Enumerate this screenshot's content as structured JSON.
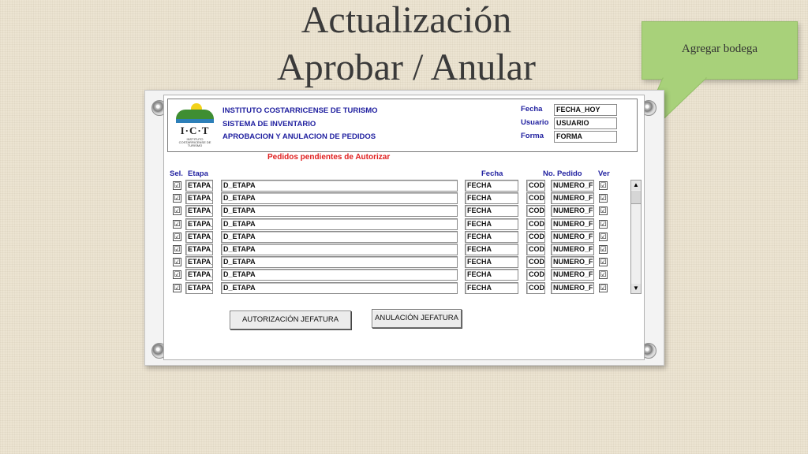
{
  "slide": {
    "title_line1": "Actualización",
    "title_line2": "Aprobar / Anular",
    "callout": "Agregar bodega"
  },
  "colors": {
    "accent_blue": "#2121a0",
    "report_red": "#e02020",
    "callout_green": "#a8d17a"
  },
  "header": {
    "logo_text": "I·C·T",
    "logo_sub": "INSTITUTO COSTARRICENSE DE TURISMO",
    "org_line1": "INSTITUTO COSTARRICENSE DE TURISMO",
    "org_line2": "SISTEMA DE INVENTARIO",
    "org_line3": "APROBACION Y ANULACION DE PEDIDOS",
    "fecha_label": "Fecha",
    "fecha_value": "FECHA_HOY",
    "usuario_label": "Usuario",
    "usuario_value": "USUARIO",
    "forma_label": "Forma",
    "forma_value": "FORMA"
  },
  "report": {
    "title": "Pedidos pendientes de Autorizar",
    "columns": {
      "sel": "Sel.",
      "etapa": "Etapa",
      "fecha": "Fecha",
      "no_pedido": "No. Pedido",
      "ver": "Ver"
    },
    "rows": [
      {
        "sel": "☑",
        "etapa": "ETAPA_",
        "d_etapa": "D_ETAPA",
        "fecha": "FECHA",
        "cod": "COD",
        "numero": "NUMERO_F",
        "ver": "☑"
      },
      {
        "sel": "☑",
        "etapa": "ETAPA_",
        "d_etapa": "D_ETAPA",
        "fecha": "FECHA",
        "cod": "COD",
        "numero": "NUMERO_F",
        "ver": "☑"
      },
      {
        "sel": "☑",
        "etapa": "ETAPA_",
        "d_etapa": "D_ETAPA",
        "fecha": "FECHA",
        "cod": "COD",
        "numero": "NUMERO_F",
        "ver": "☑"
      },
      {
        "sel": "☑",
        "etapa": "ETAPA_",
        "d_etapa": "D_ETAPA",
        "fecha": "FECHA",
        "cod": "COD",
        "numero": "NUMERO_F",
        "ver": "☑"
      },
      {
        "sel": "☑",
        "etapa": "ETAPA_",
        "d_etapa": "D_ETAPA",
        "fecha": "FECHA",
        "cod": "COD",
        "numero": "NUMERO_F",
        "ver": "☑"
      },
      {
        "sel": "☑",
        "etapa": "ETAPA_",
        "d_etapa": "D_ETAPA",
        "fecha": "FECHA",
        "cod": "COD",
        "numero": "NUMERO_F",
        "ver": "☑"
      },
      {
        "sel": "☑",
        "etapa": "ETAPA_",
        "d_etapa": "D_ETAPA",
        "fecha": "FECHA",
        "cod": "COD",
        "numero": "NUMERO_F",
        "ver": "☑"
      },
      {
        "sel": "☑",
        "etapa": "ETAPA_",
        "d_etapa": "D_ETAPA",
        "fecha": "FECHA",
        "cod": "COD",
        "numero": "NUMERO_F",
        "ver": "☑"
      },
      {
        "sel": "☑",
        "etapa": "ETAPA_",
        "d_etapa": "D_ETAPA",
        "fecha": "FECHA",
        "cod": "COD",
        "numero": "NUMERO_F",
        "ver": "☑"
      }
    ],
    "scroll_up": "▲",
    "scroll_down": "▼"
  },
  "buttons": {
    "autorizacion": "AUTORIZACIÓN JEFATURA",
    "anulacion": "ANULACIÓN JEFATURA"
  }
}
